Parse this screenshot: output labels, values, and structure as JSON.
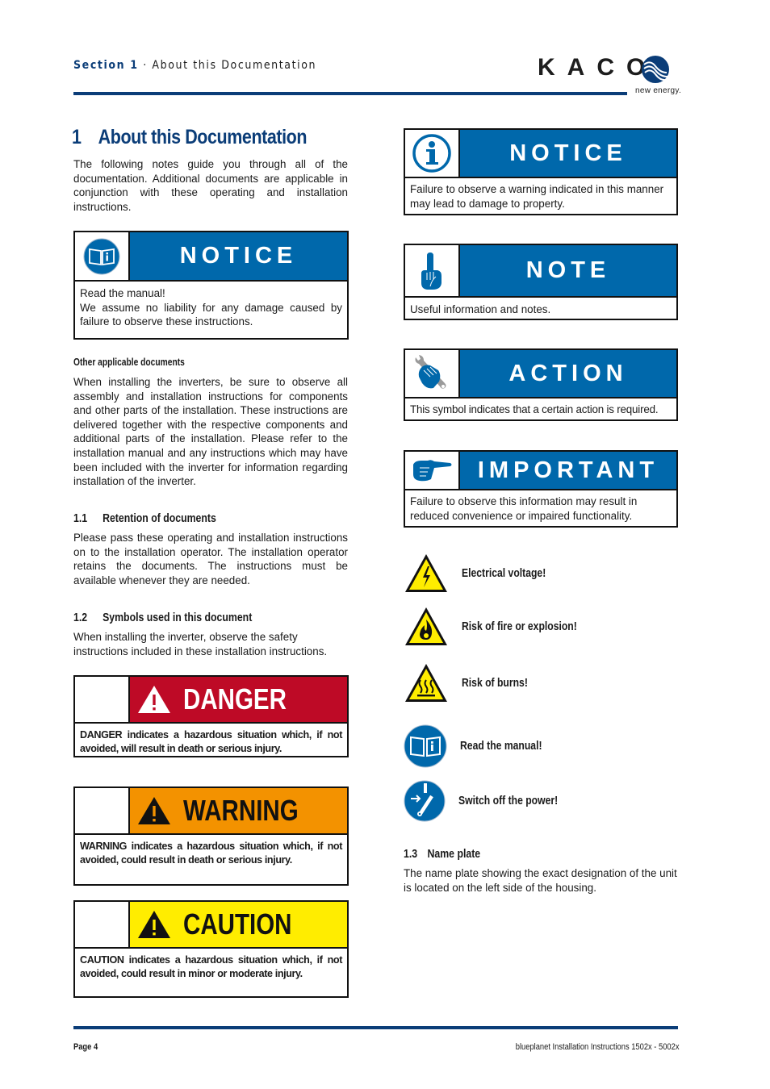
{
  "header": {
    "section_label": "Section 1",
    "separator": "·",
    "section_title": "About this Documentation",
    "logo_text": "KACO",
    "logo_tagline": "new energy.",
    "brand_color": "#0b3d78"
  },
  "left": {
    "heading_num": "1",
    "heading": "About this Documentation",
    "intro": "The following notes guide you through all of the documentation. Additional documents are applicable in conjunction with these operating and installation instructions.",
    "notice_box": {
      "icon": "read-manual-icon",
      "title": "NOTICE",
      "line1": "Read the manual!",
      "line2": "We assume no liability for any damage caused by failure to observe these instructions."
    },
    "other_docs_heading": "Other applicable documents",
    "other_docs_text": "When installing the inverters, be sure to observe all assembly and installation instructions for components and other parts of the installation. These instructions are delivered together with the respective components and additional parts of the installation. Please refer to the installation manual and any instructions which may have been included with the inverter for information regarding installation of the inverter.",
    "s11_num": "1.1",
    "s11_title": "Retention of documents",
    "s11_text": "Please pass these operating and installation instructions on to the installation operator. The installation operator retains the documents. The instructions must be available whenever they are needed.",
    "s12_num": "1.2",
    "s12_title": "Symbols used in this document",
    "s12_text": "When installing the inverter, observe the safety instructions included in these installation instructions.",
    "hazard_boxes": [
      {
        "title": "DANGER",
        "color": "#be0a26",
        "text": "DANGER indicates a hazardous situation which, if not avoided, will result in death or serious injury."
      },
      {
        "title": "WARNING",
        "color": "#f39200",
        "text": "WARNING indicates a hazardous situation which, if not avoided, could result in death or serious injury."
      },
      {
        "title": "CAUTION",
        "color": "#ffed00",
        "text": "CAUTION indicates a hazardous situation which, if not avoided, could result in minor or moderate injury."
      }
    ]
  },
  "right": {
    "info_boxes": [
      {
        "icon": "info-icon",
        "title": "NOTICE",
        "text": "Failure to observe a warning indicated in this manner may lead to damage to property."
      },
      {
        "icon": "pointing-finger-up-icon",
        "title": "NOTE",
        "text": "Useful information and notes."
      },
      {
        "icon": "hand-wrench-icon",
        "title": "ACTION",
        "text": "This symbol indicates that a certain action is required."
      },
      {
        "icon": "pointing-hand-right-icon",
        "title": "IMPORTANT",
        "text": "Failure to observe this information may result in reduced convenience or impaired functionality."
      }
    ],
    "symbols": [
      {
        "icon": "electrical-voltage-icon",
        "label": "Electrical voltage!"
      },
      {
        "icon": "fire-explosion-icon",
        "label": "Risk of fire or explosion!"
      },
      {
        "icon": "hot-surface-icon",
        "label": "Risk of burns!"
      },
      {
        "icon": "read-manual-icon",
        "label": "Read the manual!"
      },
      {
        "icon": "switch-off-power-icon",
        "label": "Switch off the power!"
      }
    ],
    "s13_num": "1.3",
    "s13_title": "Name plate",
    "s13_text": "The name plate showing the exact designation of the unit is located on the left side of the housing."
  },
  "footer": {
    "page": "Page 4",
    "doc_title": "blueplanet Installation Instructions 1502x - 5002x"
  }
}
